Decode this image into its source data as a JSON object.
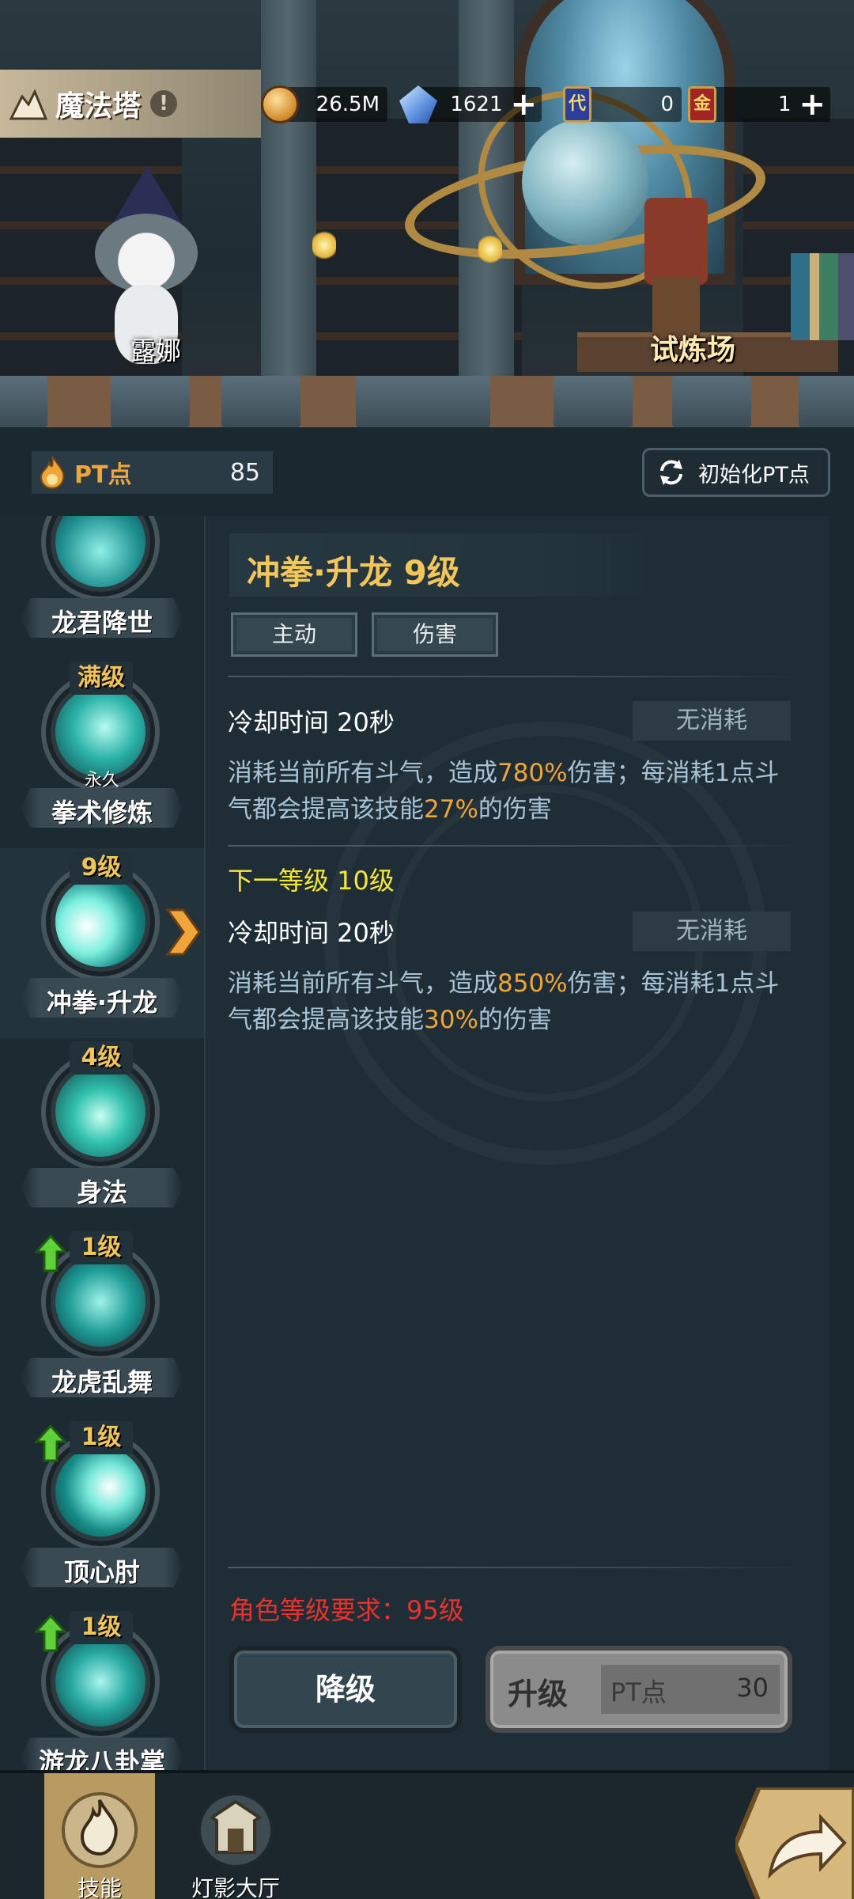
{
  "header": {
    "title": "魔法塔",
    "resources": [
      {
        "icon": "gold-coin-icon",
        "value": "26.5M",
        "has_plus": false
      },
      {
        "icon": "crystal-icon",
        "value": "1621",
        "has_plus": true
      },
      {
        "icon": "token-card-icon",
        "card_text": "代",
        "value": "0",
        "has_plus": false
      },
      {
        "icon": "gold-card-icon",
        "card_text": "金",
        "value": "1",
        "has_plus": true
      }
    ]
  },
  "scene": {
    "npc_name": "露娜",
    "arena_label": "试炼场"
  },
  "pt": {
    "label": "PT点",
    "value": "85",
    "reset_label": "初始化PT点"
  },
  "skills": [
    {
      "name": "龙君降世",
      "level": "",
      "sub": "",
      "upgradable": false,
      "selected": false
    },
    {
      "name": "拳术修炼",
      "level": "满级",
      "sub": "永久",
      "upgradable": false,
      "selected": false
    },
    {
      "name": "冲拳·升龙",
      "level": "9级",
      "sub": "",
      "upgradable": false,
      "selected": true
    },
    {
      "name": "身法",
      "level": "4级",
      "sub": "",
      "upgradable": false,
      "selected": false
    },
    {
      "name": "龙虎乱舞",
      "level": "1级",
      "sub": "",
      "upgradable": true,
      "selected": false
    },
    {
      "name": "顶心肘",
      "level": "1级",
      "sub": "",
      "upgradable": true,
      "selected": false
    },
    {
      "name": "游龙八卦掌",
      "level": "1级",
      "sub": "",
      "upgradable": true,
      "selected": false
    }
  ],
  "detail": {
    "title": "冲拳·升龙 9级",
    "tags": [
      "主动",
      "伤害"
    ],
    "current": {
      "cooldown": "冷却时间 20秒",
      "cost": "无消耗",
      "desc_parts": [
        "消耗当前所有斗气，造成",
        "780%",
        "伤害；每消耗1点斗气都会提高该技能",
        "27%",
        "的伤害"
      ]
    },
    "next_title": "下一等级 10级",
    "next": {
      "cooldown": "冷却时间 20秒",
      "cost": "无消耗",
      "desc_parts": [
        "消耗当前所有斗气，造成",
        "850%",
        "伤害；每消耗1点斗气都会提高该技能",
        "30%",
        "的伤害"
      ]
    },
    "requirement": "角色等级要求：95级",
    "downgrade_label": "降级",
    "upgrade_label": "升级",
    "upgrade_cost_label": "PT点",
    "upgrade_cost_value": "30"
  },
  "bottom_nav": [
    {
      "label": "技能",
      "icon": "flame-skill-icon",
      "active": true
    },
    {
      "label": "灯影大厅",
      "icon": "hall-icon",
      "active": false
    }
  ],
  "colors": {
    "gold_text": "#f3c65a",
    "highlight": "#f0a53a",
    "requirement_red": "#e8322b",
    "next_level_yellow": "#f5e63a"
  }
}
